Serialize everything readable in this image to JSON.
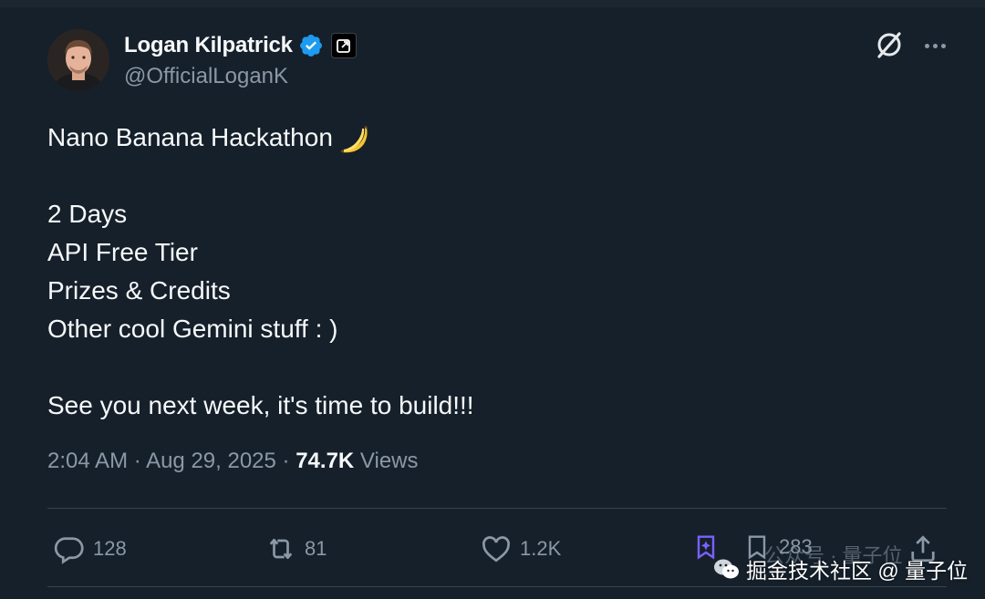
{
  "author": {
    "display_name": "Logan Kilpatrick",
    "handle": "@OfficialLoganK",
    "verified": true
  },
  "tweet": {
    "lines": [
      "Nano Banana Hackathon",
      "",
      "2 Days",
      "API Free Tier",
      "Prizes & Credits",
      "Other cool Gemini stuff : )",
      "",
      "See you next week, it's time to build!!!"
    ],
    "emoji_icon": "banana-icon"
  },
  "meta": {
    "time": "2:04 AM",
    "separator": " · ",
    "date": "Aug 29, 2025",
    "views_count": "74.7K",
    "views_label": "Views"
  },
  "actions": {
    "replies": "128",
    "reposts": "81",
    "likes": "1.2K",
    "bookmarks": "283"
  },
  "watermark": {
    "text": "掘金技术社区 @ 量子位",
    "faint_text": "公众号 · 量子位"
  },
  "colors": {
    "background": "#15202b",
    "text": "#f7f9f9",
    "muted": "#8b98a5",
    "verified": "#1d9bf0",
    "divider": "#38444d"
  }
}
